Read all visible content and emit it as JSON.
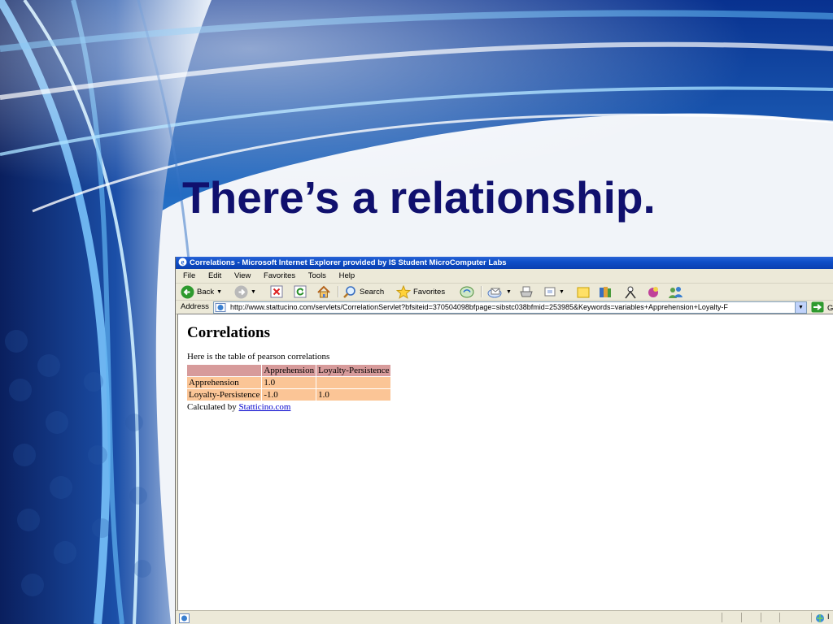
{
  "slide": {
    "title": "There’s a relationship."
  },
  "browser": {
    "title": "Correlations - Microsoft Internet Explorer provided by IS Student MicroComputer Labs",
    "menu": [
      "File",
      "Edit",
      "View",
      "Favorites",
      "Tools",
      "Help"
    ],
    "toolbar": {
      "back_label": "Back",
      "search_label": "Search",
      "favorites_label": "Favorites"
    },
    "address": {
      "label": "Address",
      "url": "http://www.stattucino.com/servlets/CorrelationServlet?bfsiteid=370504098bfpage=sibstc038bfmid=253985&Keywords=variables+Apprehension+Loyalty-F",
      "go_label": "G"
    },
    "status": {
      "zone_text": "I"
    }
  },
  "page": {
    "heading": "Correlations",
    "intro": "Here is the table of pearson correlations",
    "table": {
      "headers": [
        "",
        "Apprehension",
        "Loyalty-Persistence"
      ],
      "rows": [
        [
          "Apprehension",
          "1.0",
          ""
        ],
        [
          "Loyalty-Persistence",
          "-1.0",
          "1.0"
        ]
      ]
    },
    "calculated_by": "Calculated by",
    "link_text": "Statticino.com"
  },
  "colors": {
    "title": "#10106e",
    "table_header": "#d79b9b",
    "table_cell": "#fbc596",
    "link": "#0000cc",
    "titlebar": "#0f4fc8"
  }
}
